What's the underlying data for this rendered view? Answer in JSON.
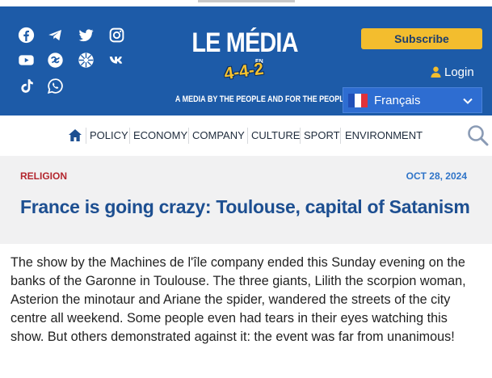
{
  "header": {
    "logo": {
      "main": "LE MÉDIA",
      "en": "EN",
      "score": "4-4-2",
      "tagline": "A MEDIA BY THE PEOPLE AND FOR THE PEOPLE"
    },
    "social_icons": [
      "facebook-icon",
      "telegram-icon",
      "twitter-icon",
      "instagram-icon",
      "youtube-icon",
      "odysee-icon",
      "rumble-icon",
      "vk-icon",
      "tiktok-icon",
      "whatsapp-icon"
    ],
    "subscribe_label": "Subscribe",
    "login_label": "Login",
    "language": "Français",
    "colors": {
      "background": "#1d5ba8",
      "accent": "#f3bd2e",
      "language_box": "#2e6dd1"
    }
  },
  "nav": {
    "items": [
      {
        "label": "POLICY"
      },
      {
        "label": "ECONOMY"
      },
      {
        "label": "COMPANY"
      },
      {
        "label": "CULTURE"
      },
      {
        "label": "SPORT"
      },
      {
        "label": "ENVIRONMENT"
      }
    ]
  },
  "article": {
    "category": "RELIGION",
    "date": "OCT 28, 2024",
    "title": "France is going crazy: Toulouse, capital of Satanism",
    "lead": "The show by the Machines de l'île company ended this Sunday evening on the banks of the Garonne in Toulouse. The three giants, Lilith the scorpion woman, Asterion the minotaur and Ariane the spider, wandered the streets of the city centre all weekend. Some people even had tears in their eyes watching this show. But others demonstrated against it: the event was far from unanimous!",
    "colors": {
      "category": "#b3262e",
      "date": "#2f74c8",
      "title": "#1d4f91"
    }
  }
}
